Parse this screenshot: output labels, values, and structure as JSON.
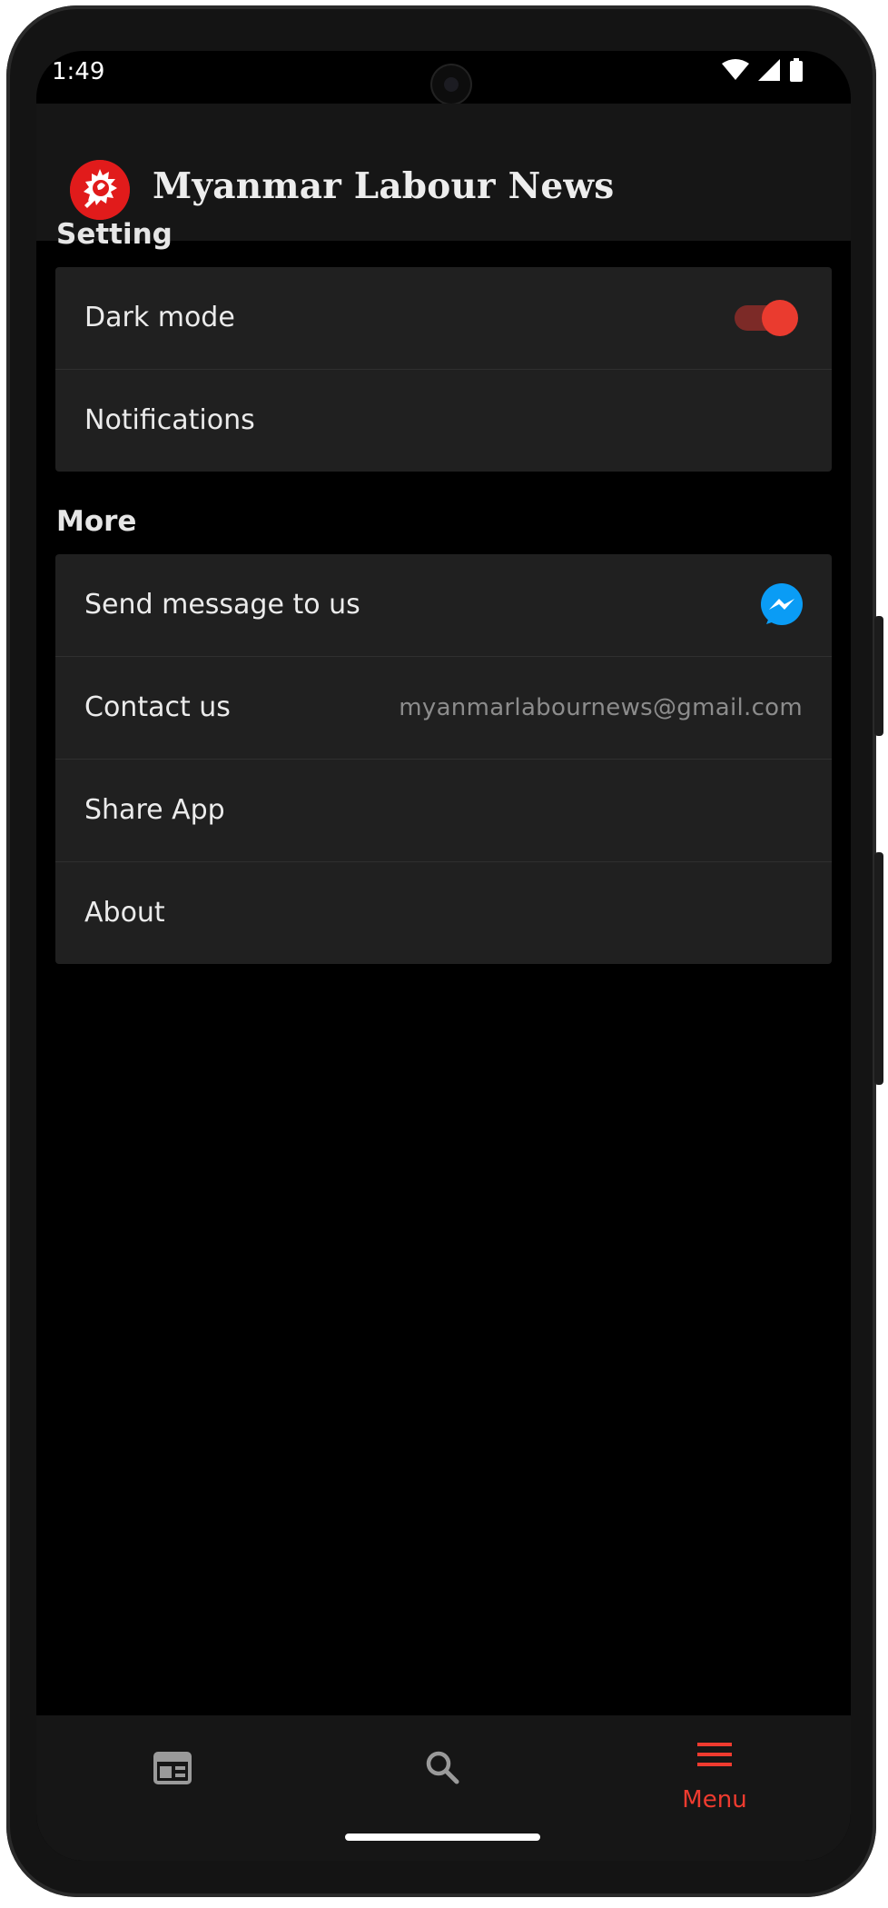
{
  "status_bar": {
    "time": "1:49"
  },
  "app_bar": {
    "title": "Myanmar Labour News",
    "logo_icon": "app-logo-icon"
  },
  "settings": {
    "heading": "Setting",
    "dark_mode": {
      "label": "Dark mode",
      "enabled": true
    },
    "notifications": {
      "label": "Notifications"
    }
  },
  "more": {
    "heading": "More",
    "send_message": {
      "label": "Send message to us",
      "icon": "messenger-icon"
    },
    "contact": {
      "label": "Contact us",
      "value": "myanmarlabournews@gmail.com"
    },
    "share": {
      "label": "Share App"
    },
    "about": {
      "label": "About"
    }
  },
  "bottom_nav": {
    "items": [
      {
        "icon": "newspaper-icon",
        "label": "",
        "active": false
      },
      {
        "icon": "search-icon",
        "label": "",
        "active": false
      },
      {
        "icon": "menu-icon",
        "label": "Menu",
        "active": true
      }
    ]
  },
  "colors": {
    "accent": "#ea3b2f",
    "background": "#000000",
    "card": "#202020",
    "app_bar": "#161616",
    "messenger": "#0a9cf5"
  }
}
